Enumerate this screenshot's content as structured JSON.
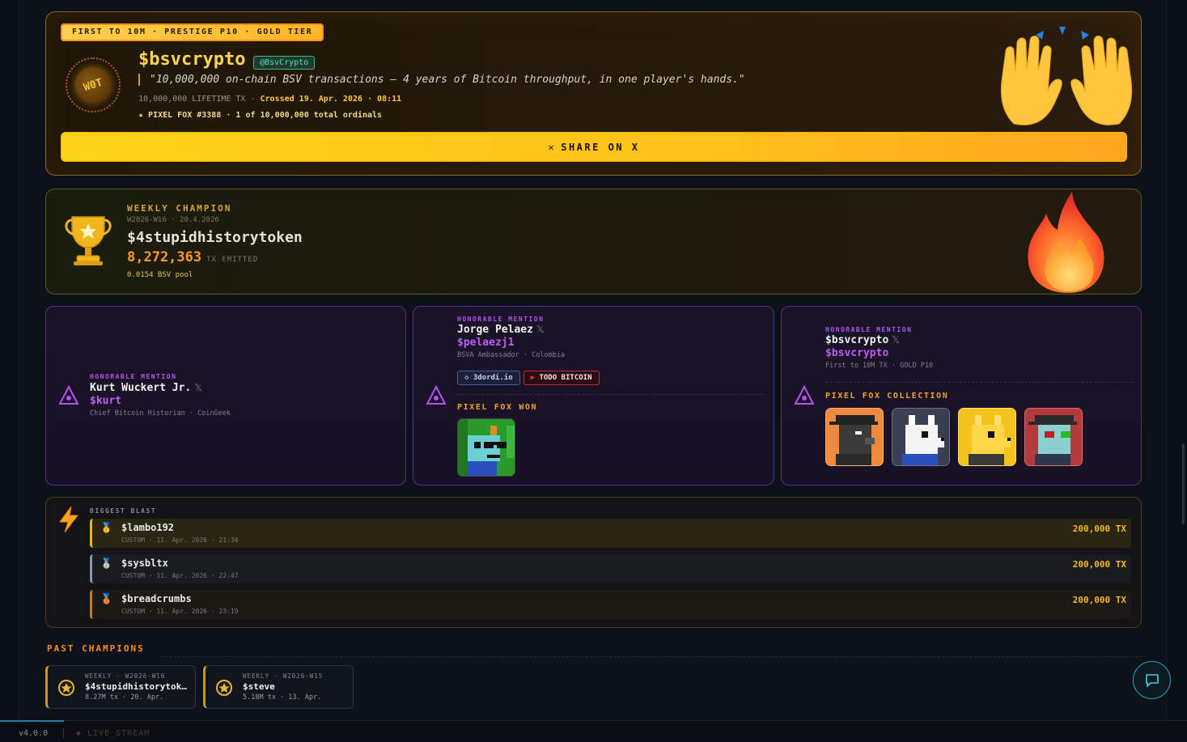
{
  "hero": {
    "badge": "FIRST TO 10M · PRESTIGE P10 · GOLD TIER",
    "seal_text": "W0T",
    "name": "$bsvcrypto",
    "handle": "@BsvCrypto",
    "quote": "\"10,000,000 on-chain BSV transactions — 4 years of Bitcoin throughput, in one player's hands.\"",
    "stats_prefix": "10,000,000 LIFETIME TX · ",
    "stats_crossed": "Crossed 19. Apr. 2026 · 08:11",
    "fox_line": "★ PIXEL FOX #3388 · 1 of 10,000,000 total ordinals",
    "share_label": "SHARE ON X",
    "share_icon": "x-icon",
    "emoji": "raised-hands-icon"
  },
  "weekly": {
    "label": "WEEKLY CHAMPION",
    "sub": "W2026-W16 · 20.4.2026",
    "name": "$4stupidhistorytoken",
    "tx": "8,272,363",
    "tx_unit": "TX EMITTED",
    "pool": "0.0154 BSV pool",
    "icon": "trophy-icon",
    "emoji": "fire-icon"
  },
  "mentions": [
    {
      "label": "HONORABLE MENTION",
      "name": "Kurt Wuckert Jr.",
      "handle": "$kurt",
      "desc": "Chief Bitcoin Historian · CoinGeek"
    },
    {
      "label": "HONORABLE MENTION",
      "name": "Jorge Pelaez",
      "handle": "$pelaezj1",
      "desc": "BSVA Ambassador · Colombia",
      "chips": [
        "3dordi.io",
        "TODO BITCOIN"
      ],
      "section": "PIXEL FOX WON"
    },
    {
      "label": "HONORABLE MENTION",
      "name": "$bsvcrypto",
      "handle": "$bsvcrypto",
      "desc": "First to 10M TX · GOLD P10",
      "section": "PIXEL FOX COLLECTION"
    }
  ],
  "x_glyph": "𝕏",
  "blast": {
    "label": "BIGGEST BLAST",
    "rows": [
      {
        "medal": "gold-medal-icon",
        "glyph": "🥇",
        "name": "$lambo192",
        "meta": "CUSTOM · 11. Apr. 2026 · 21:34",
        "amount": "200,000 TX",
        "accent": "#e8b820"
      },
      {
        "medal": "silver-medal-icon",
        "glyph": "🥈",
        "name": "$sysbltx",
        "meta": "CUSTOM · 11. Apr. 2026 · 22:47",
        "amount": "200,000 TX",
        "accent": "#8a96b0"
      },
      {
        "medal": "bronze-medal-icon",
        "glyph": "🥉",
        "name": "$breadcrumbs",
        "meta": "CUSTOM · 11. Apr. 2026 · 23:19",
        "amount": "200,000 TX",
        "accent": "#c07a3a"
      }
    ]
  },
  "past": {
    "title": "PAST CHAMPIONS",
    "cards": [
      {
        "sub": "WEEKLY · W2026-W16",
        "name": "$4stupidhistorytok…",
        "meta": "8.27M tx · 20. Apr."
      },
      {
        "sub": "WEEKLY · W2026-W15",
        "name": "$steve",
        "meta": "5.18M tx · 13. Apr."
      }
    ]
  },
  "footer": {
    "version": "v4.0.0",
    "live": "◆ LIVE_STREAM"
  },
  "colors": {
    "gold": "#ffd54a",
    "orange": "#ff9a22",
    "purple": "#b452f0",
    "teal": "#1fa9b8"
  }
}
